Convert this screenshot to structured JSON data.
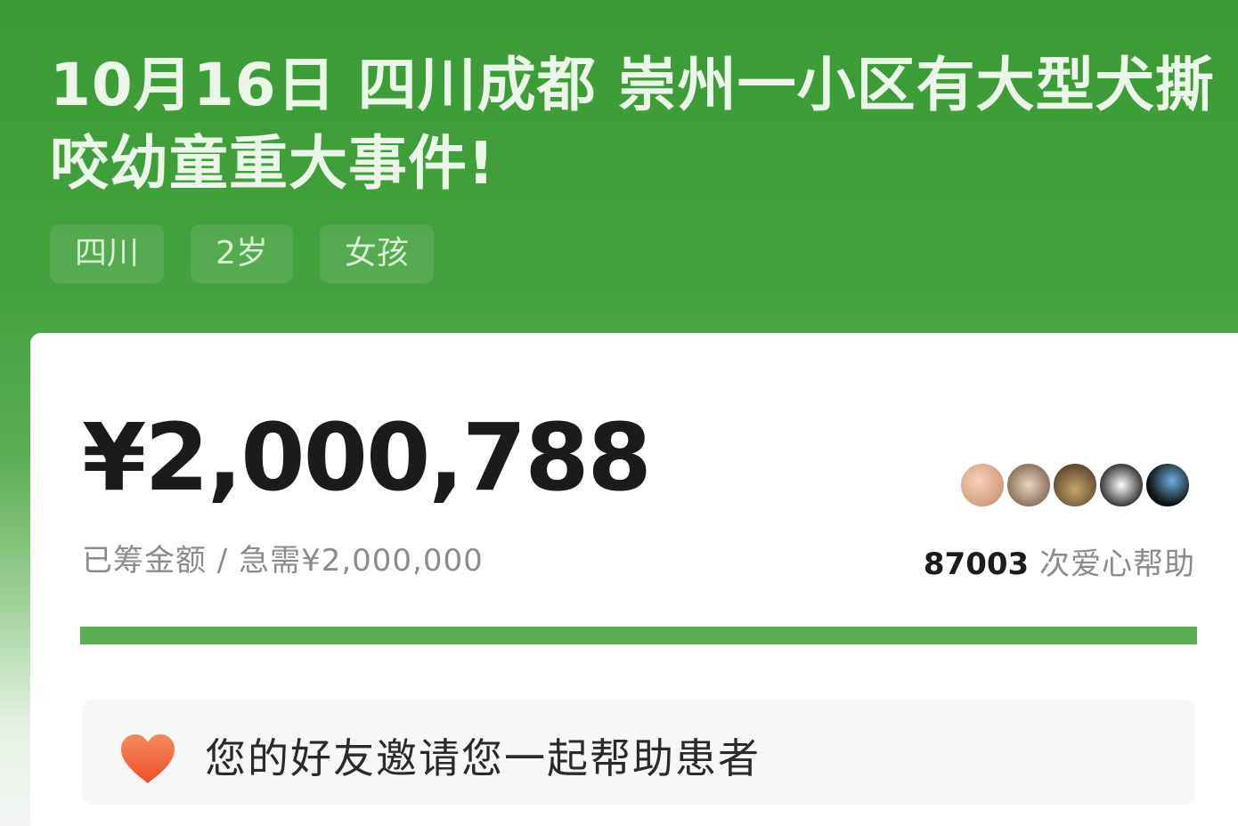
{
  "header": {
    "title": "10月16日 四川成都 崇州一小区有大型犬撕咬幼童重大事件!",
    "tags": [
      "四川",
      "2岁",
      "女孩"
    ]
  },
  "fundraising": {
    "amount_raised": "¥2,000,788",
    "subtitle": "已筹金额 / 急需¥2,000,000",
    "helper_count": "87003",
    "helper_suffix": " 次爱心帮助",
    "progress": 1.0,
    "progress_color": "#5aae52"
  },
  "invite": {
    "icon": "heart-icon",
    "text": "您的好友邀请您一起帮助患者",
    "heart_color": "#f0603a"
  },
  "colors": {
    "header_green": "#43a23d",
    "card_bg": "#ffffff"
  }
}
